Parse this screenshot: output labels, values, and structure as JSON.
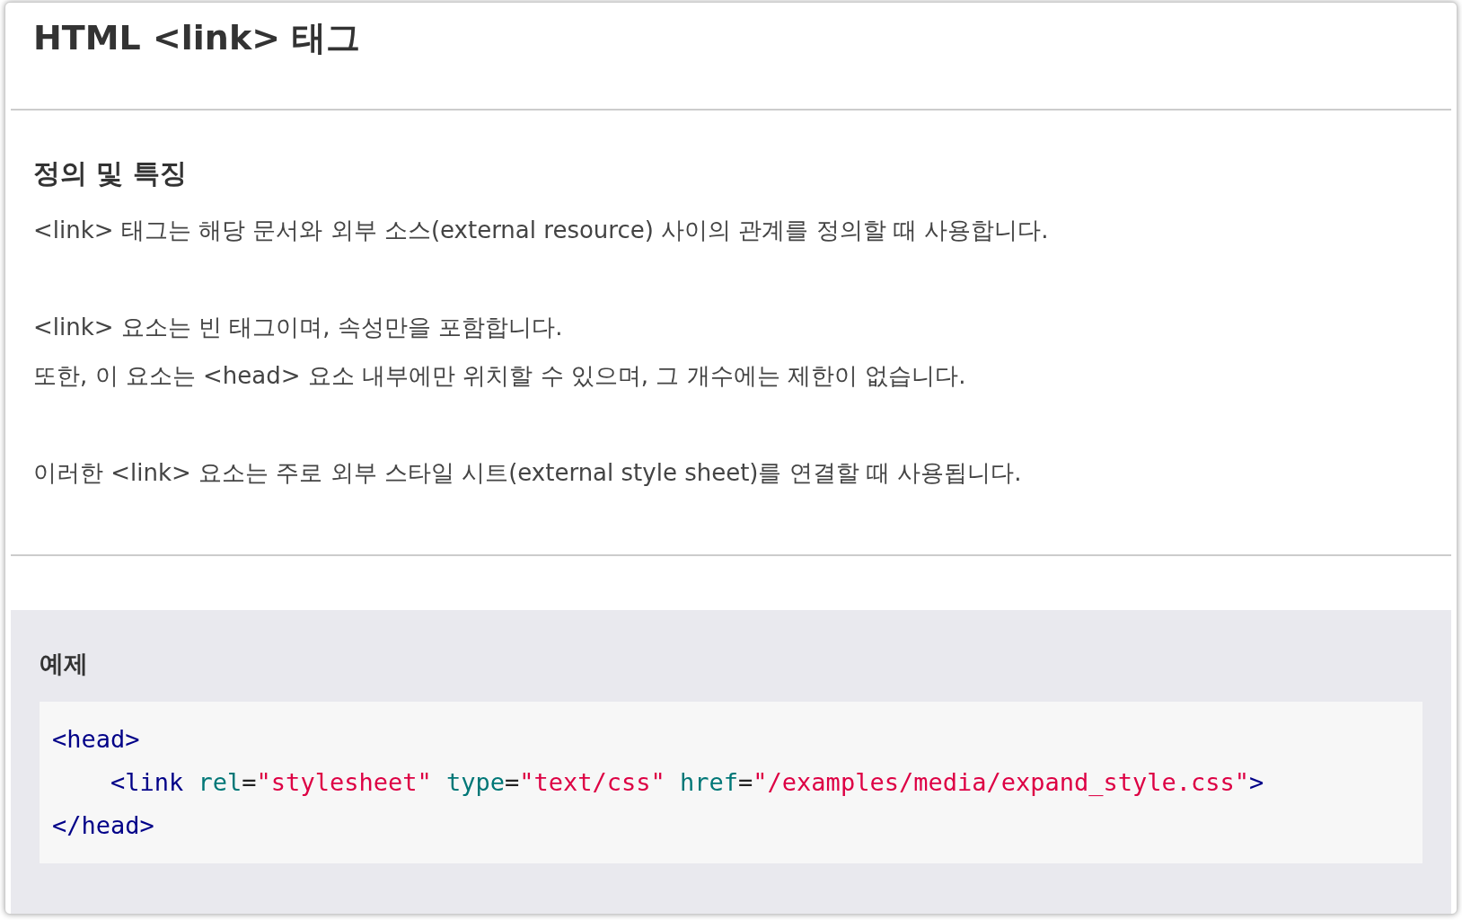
{
  "title": "HTML <link> 태그",
  "section": {
    "heading": "정의 및 특징",
    "paragraphs": [
      {
        "lines": [
          "<link> 태그는 해당 문서와 외부 소스(external resource) 사이의 관계를 정의할 때 사용합니다."
        ]
      },
      {
        "lines": [
          "<link> 요소는 빈 태그이며, 속성만을 포함합니다.",
          "또한, 이 요소는 <head> 요소 내부에만 위치할 수 있으며, 그 개수에는 제한이 없습니다."
        ]
      },
      {
        "lines": [
          "이러한 <link> 요소는 주로 외부 스타일 시트(external style sheet)를 연결할 때 사용됩니다."
        ]
      }
    ]
  },
  "example": {
    "heading": "예제",
    "code_lines": [
      [
        {
          "kind": "tag",
          "text": "<head>"
        }
      ],
      [
        {
          "kind": "tag",
          "text": "    <link "
        },
        {
          "kind": "attr",
          "text": "rel"
        },
        {
          "kind": "punct",
          "text": "="
        },
        {
          "kind": "string",
          "text": "\"stylesheet\" "
        },
        {
          "kind": "attr",
          "text": "type"
        },
        {
          "kind": "punct",
          "text": "="
        },
        {
          "kind": "string",
          "text": "\"text/css\" "
        },
        {
          "kind": "attr",
          "text": "href"
        },
        {
          "kind": "punct",
          "text": "="
        },
        {
          "kind": "string",
          "text": "\"/examples/media/expand_style.css\""
        },
        {
          "kind": "tag",
          "text": ">"
        }
      ],
      [
        {
          "kind": "tag",
          "text": "</head>"
        }
      ]
    ]
  }
}
